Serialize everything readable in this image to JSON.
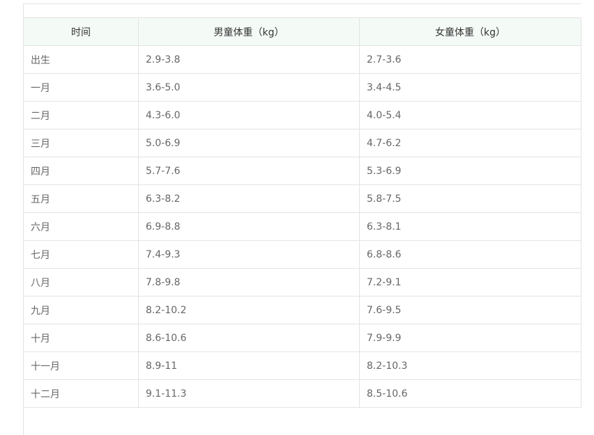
{
  "table": {
    "headers": [
      "时间",
      "男童体重（kg）",
      "女童体重（kg）"
    ],
    "rows": [
      [
        "出生",
        "2.9-3.8",
        "2.7-3.6"
      ],
      [
        "一月",
        "3.6-5.0",
        "3.4-4.5"
      ],
      [
        "二月",
        "4.3-6.0",
        "4.0-5.4"
      ],
      [
        "三月",
        "5.0-6.9",
        "4.7-6.2"
      ],
      [
        "四月",
        "5.7-7.6",
        "5.3-6.9"
      ],
      [
        "五月",
        "6.3-8.2",
        "5.8-7.5"
      ],
      [
        "六月",
        "6.9-8.8",
        "6.3-8.1"
      ],
      [
        "七月",
        "7.4-9.3",
        "6.8-8.6"
      ],
      [
        "八月",
        "7.8-9.8",
        "7.2-9.1"
      ],
      [
        "九月",
        "8.2-10.2",
        "7.6-9.5"
      ],
      [
        "十月",
        "8.6-10.6",
        "7.9-9.9"
      ],
      [
        "十一月",
        "8.9-11",
        "8.2-10.3"
      ],
      [
        "十二月",
        "9.1-11.3",
        "8.5-10.6"
      ]
    ]
  },
  "colors": {
    "header_bg": "#f4fbf7",
    "border": "#e3e3e3",
    "header_text": "#333333",
    "cell_text": "#666666"
  }
}
